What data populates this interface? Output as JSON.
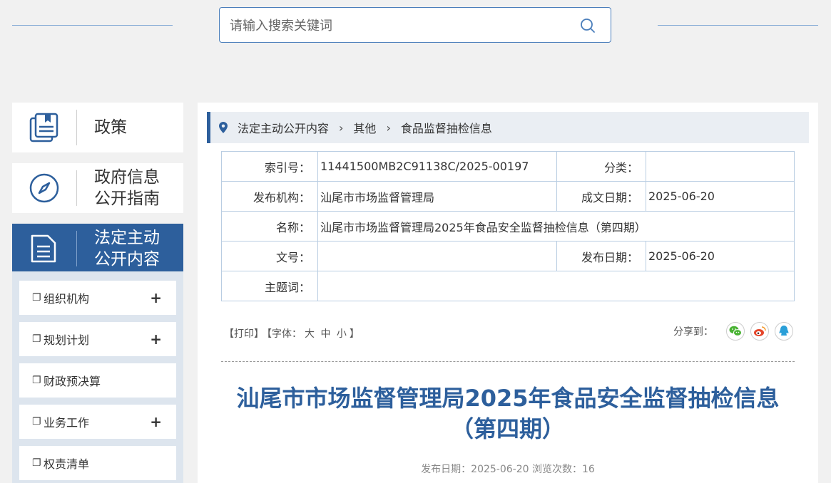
{
  "search": {
    "placeholder": "请输入搜索关键词"
  },
  "sidebar": {
    "categories": [
      {
        "label": "政策"
      },
      {
        "label_line1": "政府信息",
        "label_line2": "公开指南"
      },
      {
        "label_line1": "法定主动",
        "label_line2": "公开内容"
      }
    ],
    "subitems": [
      {
        "label": "组织机构",
        "expand": "+"
      },
      {
        "label": "规划计划",
        "expand": "+"
      },
      {
        "label": "财政预决算"
      },
      {
        "label": "业务工作",
        "expand": "+"
      },
      {
        "label": "权责清单"
      }
    ]
  },
  "breadcrumb": [
    "法定主动公开内容",
    "其他",
    "食品监督抽检信息"
  ],
  "meta": {
    "index_label": "索引号：",
    "index_value": "11441500MB2C91138C/2025-00197",
    "category_label": "分类：",
    "category_value": "",
    "publisher_label": "发布机构：",
    "publisher_value": "汕尾市市场监督管理局",
    "written_label": "成文日期：",
    "written_value": "2025-06-20",
    "name_label": "名称：",
    "name_value": "汕尾市市场监督管理局2025年食品安全监督抽检信息（第四期）",
    "docno_label": "文号：",
    "docno_value": "",
    "pubdate_label": "发布日期：",
    "pubdate_value": "2025-06-20",
    "keywords_label": "主题词：",
    "keywords_value": ""
  },
  "tools": {
    "print": "【打印】",
    "font_prefix": "【字体：",
    "font_large": "大",
    "font_medium": "中",
    "font_small": "小",
    "font_suffix": "】",
    "share_label": "分享到："
  },
  "article": {
    "title_line1": "汕尾市市场监督管理局2025年食品安全监督抽检信息",
    "title_line2": "（第四期）",
    "pubinfo": "发布日期：2025-06-20   浏览次数：16"
  },
  "colors": {
    "brand": "#2d5f9c",
    "wechat": "#49b233",
    "weibo": "#e5462b",
    "qq": "#2a9fd8"
  }
}
